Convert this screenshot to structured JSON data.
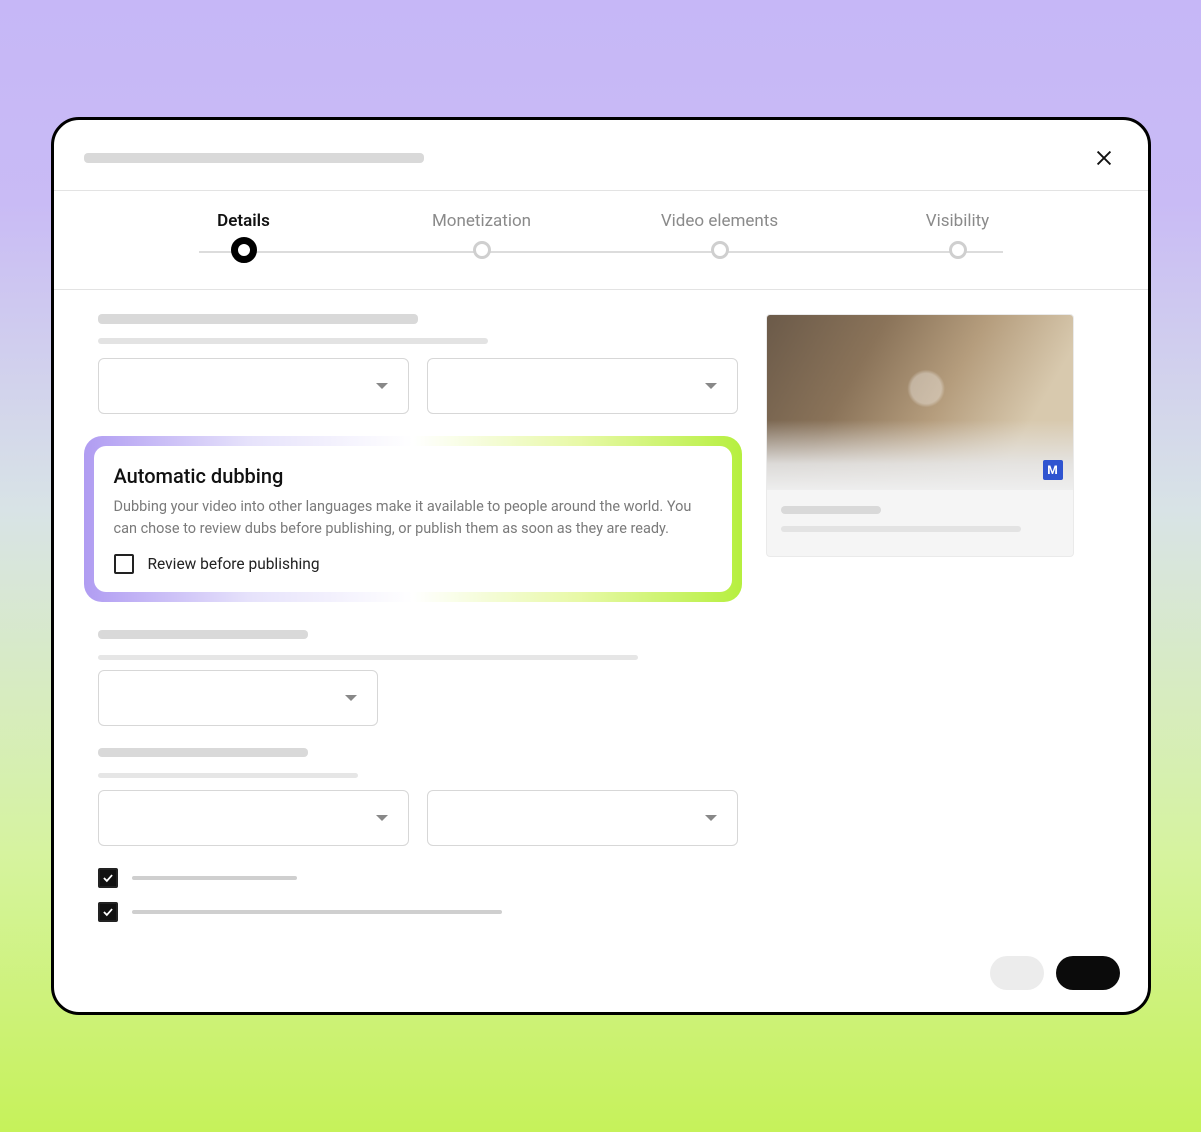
{
  "stepper": {
    "steps": [
      {
        "label": "Details",
        "active": true
      },
      {
        "label": "Monetization",
        "active": false
      },
      {
        "label": "Video elements",
        "active": false
      },
      {
        "label": "Visibility",
        "active": false
      }
    ]
  },
  "highlight": {
    "title": "Automatic dubbing",
    "description": "Dubbing your video into other languages make it available to people around the world. You can chose to review dubs before publishing, or publish them as soon as they are ready.",
    "checkbox_label": "Review before publishing",
    "checkbox_checked": false
  },
  "bottom_checks": [
    {
      "checked": true
    },
    {
      "checked": true
    }
  ],
  "preview": {
    "badge": "M"
  }
}
